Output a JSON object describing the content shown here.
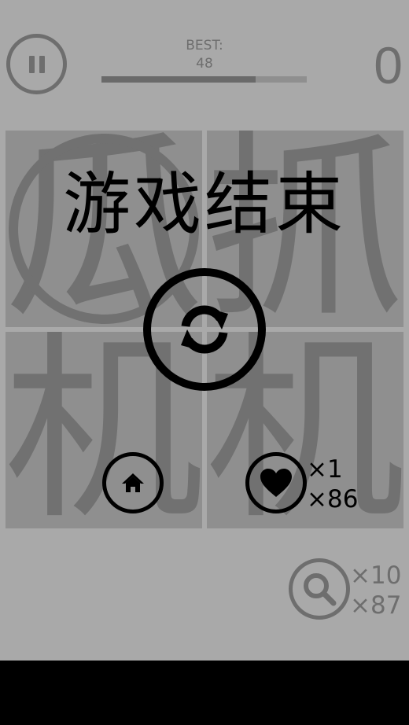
{
  "header": {
    "pause_icon": "pause-icon",
    "best_label": "BEST:",
    "best_value": "48",
    "progress_fraction": 0.75,
    "score": "0"
  },
  "board": {
    "cells": [
      {
        "char": "瓜",
        "stamp": true
      },
      {
        "char": "抓",
        "stamp": false
      },
      {
        "char": "机",
        "stamp": false
      },
      {
        "char": "机",
        "stamp": false
      }
    ]
  },
  "overlay": {
    "title": "游戏结束",
    "restart_icon": "refresh-icon",
    "home_icon": "home-icon",
    "heart_icon": "heart-icon",
    "heart_cost": "×1",
    "heart_count": "×86"
  },
  "powerup": {
    "search_icon": "magnifier-icon",
    "search_cost": "×10",
    "search_count": "×87"
  },
  "colors": {
    "background": "#a9a9a9",
    "cell": "#8f8f8f",
    "glyph": "#717171",
    "ui_grey": "#6e6e6e",
    "overlay_black": "#000000"
  }
}
